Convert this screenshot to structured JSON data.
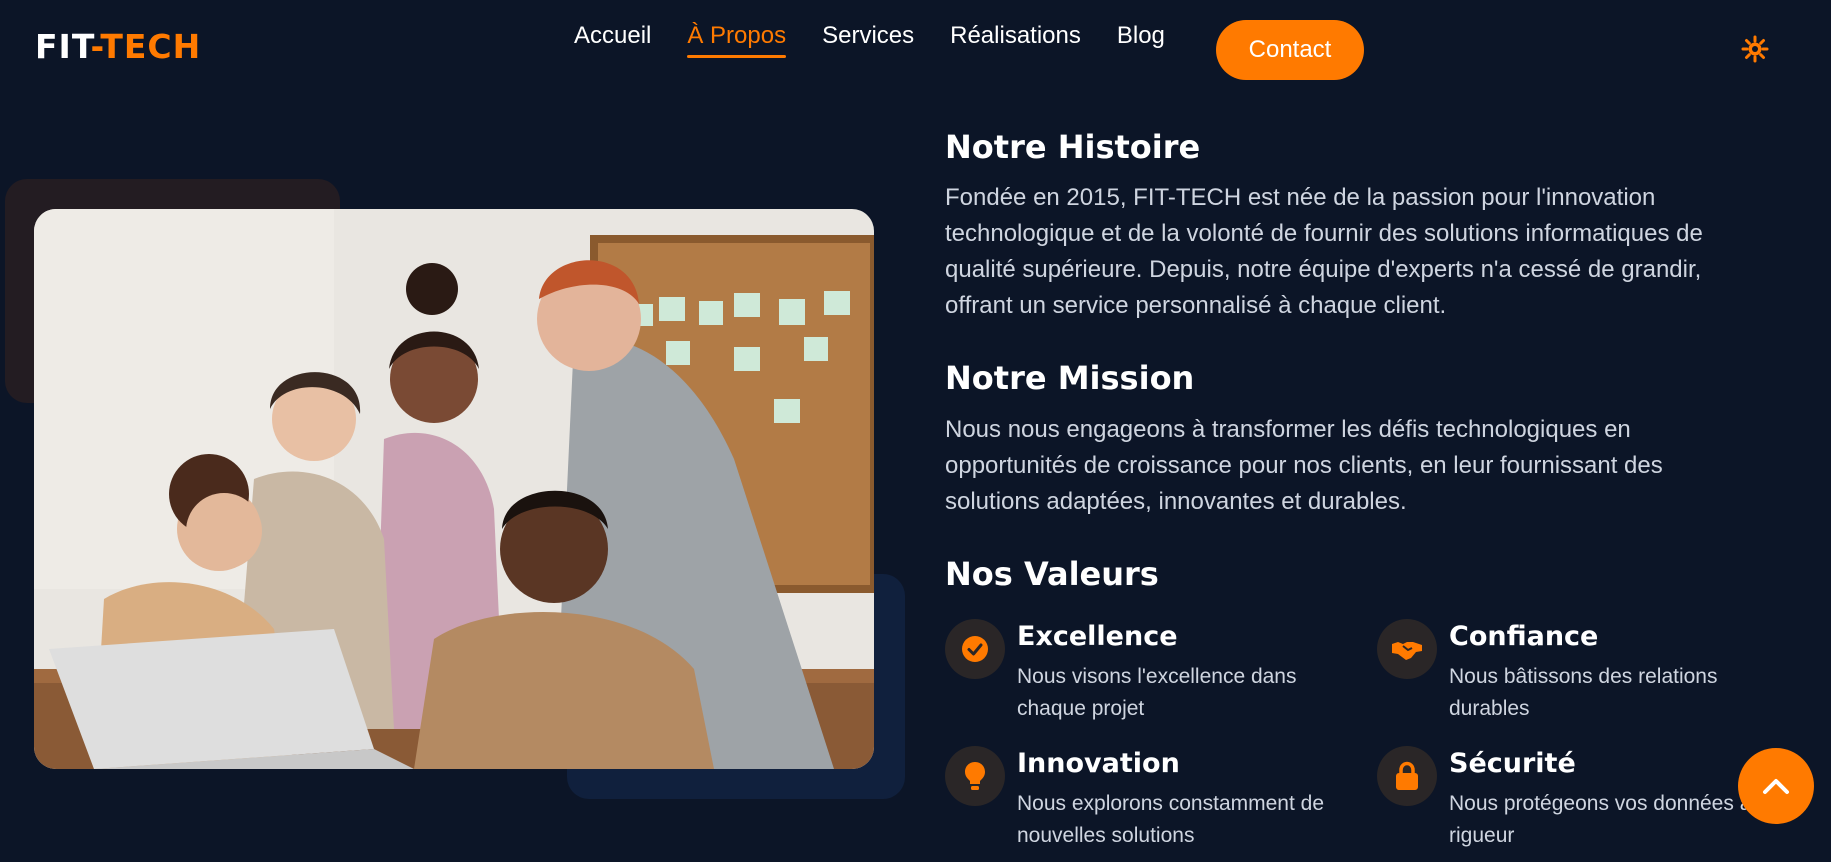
{
  "header": {
    "logo": {
      "part1": "FIT",
      "dash": "-",
      "part2": "TECH"
    },
    "nav": [
      "Accueil",
      "À Propos",
      "Services",
      "Réalisations",
      "Blog"
    ],
    "active_nav": "À Propos",
    "contact_label": "Contact",
    "theme_icon": "sun-icon"
  },
  "colors": {
    "background": "#0c1527",
    "accent": "#ff7a00",
    "text": "#ffffff",
    "muted_text": "#cfd5e0"
  },
  "image": {
    "description_icon": "team-photo"
  },
  "histoire": {
    "title": "Notre Histoire",
    "text": "Fondée en 2015, FIT-TECH est née de la passion pour l'innovation technologique et de la volonté de fournir des solutions informatiques de qualité supérieure. Depuis, notre équipe d'experts n'a cessé de grandir, offrant un service personnalisé à chaque client."
  },
  "mission": {
    "title": "Notre Mission",
    "text": "Nous nous engageons à transformer les défis technologiques en opportunités de croissance pour nos clients, en leur fournissant des solutions adaptées, innovantes et durables."
  },
  "valeurs": {
    "title": "Nos Valeurs",
    "items": [
      {
        "icon": "check-circle-icon",
        "title": "Excellence",
        "text": "Nous visons l'excellence dans chaque projet"
      },
      {
        "icon": "handshake-icon",
        "title": "Confiance",
        "text": "Nous bâtissons des relations durables"
      },
      {
        "icon": "lightbulb-icon",
        "title": "Innovation",
        "text": "Nous explorons constamment de nouvelles solutions"
      },
      {
        "icon": "lock-icon",
        "title": "Sécurité",
        "text": "Nous protégeons vos données avec rigueur"
      }
    ]
  },
  "scroll_top_icon": "chevron-up-icon"
}
